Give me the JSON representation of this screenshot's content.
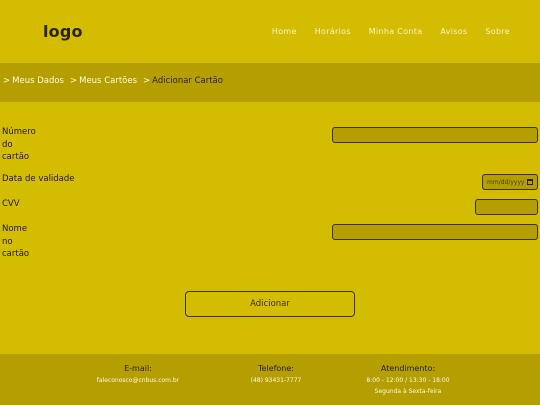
{
  "header": {
    "logo": "logo",
    "nav": [
      "Home",
      "Horários",
      "Minha Conta",
      "Avisos",
      "Sobre"
    ]
  },
  "breadcrumb": {
    "items": [
      {
        "sep": ">",
        "label": "Meus Dados"
      },
      {
        "sep": ">",
        "label": "Meus Cartões"
      },
      {
        "sep": ">",
        "label": "Adicionar Cartão"
      }
    ]
  },
  "form": {
    "number_label": [
      "Número",
      "do",
      "cartão"
    ],
    "validity_label": "Data de validade",
    "validity_placeholder": "mm/dd/yyyy",
    "cvv_label": "CVV",
    "name_label": [
      "Nome",
      "no",
      "cartão"
    ],
    "number_value": "",
    "cvv_value": "",
    "name_value": "",
    "submit_label": "Adicionar"
  },
  "footer": {
    "email": {
      "title": "E-mail:",
      "value": "faleconosco@cnbus.com.br"
    },
    "phone": {
      "title": "Telefone:",
      "value": "(48) 93431-7777"
    },
    "hours": {
      "title": "Atendimento:",
      "lines": [
        "8:00 - 12:00 / 13:30 - 18:00",
        "Segunda à Sexta-feira"
      ]
    }
  },
  "colors": {
    "background": "#d4bc00",
    "band": "#b49e00",
    "text_dark": "#1e1a00",
    "text_light": "#fffbe0"
  }
}
